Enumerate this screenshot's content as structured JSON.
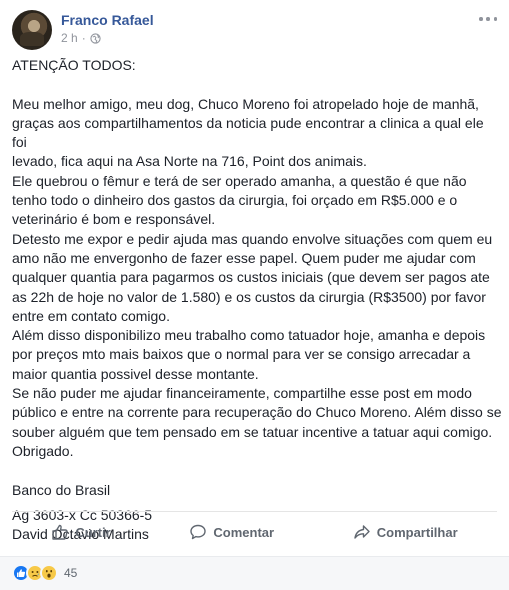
{
  "post": {
    "author": "Franco Rafael",
    "time": "2 h",
    "separator": "·",
    "privacy_icon": "globe-icon",
    "more_icon": "more-options-icon"
  },
  "content": {
    "heading": "ATENÇÃO TODOS:",
    "paragraph1": "Meu melhor amigo, meu dog, Chuco Moreno foi atropelado hoje de manhã,\ngraças aos compartilhamentos da noticia pude encontrar a clinica a qual ele foi\nlevado, fica aqui na Asa Norte na 716, Point dos animais.\nEle quebrou o fêmur e terá de ser operado amanha, a questão é que não\ntenho todo o dinheiro dos gastos da cirurgia, foi orçado em R$5.000 e o\nveterinário é bom e responsável.\nDetesto me expor e pedir ajuda mas quando envolve situações com quem eu\namo não me envergonho de fazer esse papel. Quem puder me ajudar com\nqualquer quantia para pagarmos os custos iniciais (que devem ser pagos ate\nas 22h de hoje no valor de 1.580) e os custos da cirurgia (R$3500) por favor\nentre em contato comigo.\nAlém disso disponibilizo meu trabalho como tatuador hoje, amanha e depois\npor preços mto mais baixos que o normal para ver se consigo arrecadar a\nmaior quantia possivel desse montante.\nSe não puder me ajudar financeiramente, compartilhe esse post em modo\npúblico e entre na corrente para recuperação do Chuco Moreno. Além disso se\nsouber alguém que tem pensado em se tatuar incentive a tatuar aqui comigo.\nObrigado.",
    "bank": "Banco do Brasil",
    "account": "Ag 3603-x Cc 50366-5\nDavid Octavio Martins"
  },
  "actions": {
    "like": "Curtir",
    "comment": "Comentar",
    "share": "Compartilhar"
  },
  "reactions": {
    "types": [
      "like",
      "sad",
      "wow"
    ],
    "count": "45"
  },
  "colors": {
    "author": "#365899",
    "like_blue": "#1877f2",
    "muted": "#90949c"
  }
}
